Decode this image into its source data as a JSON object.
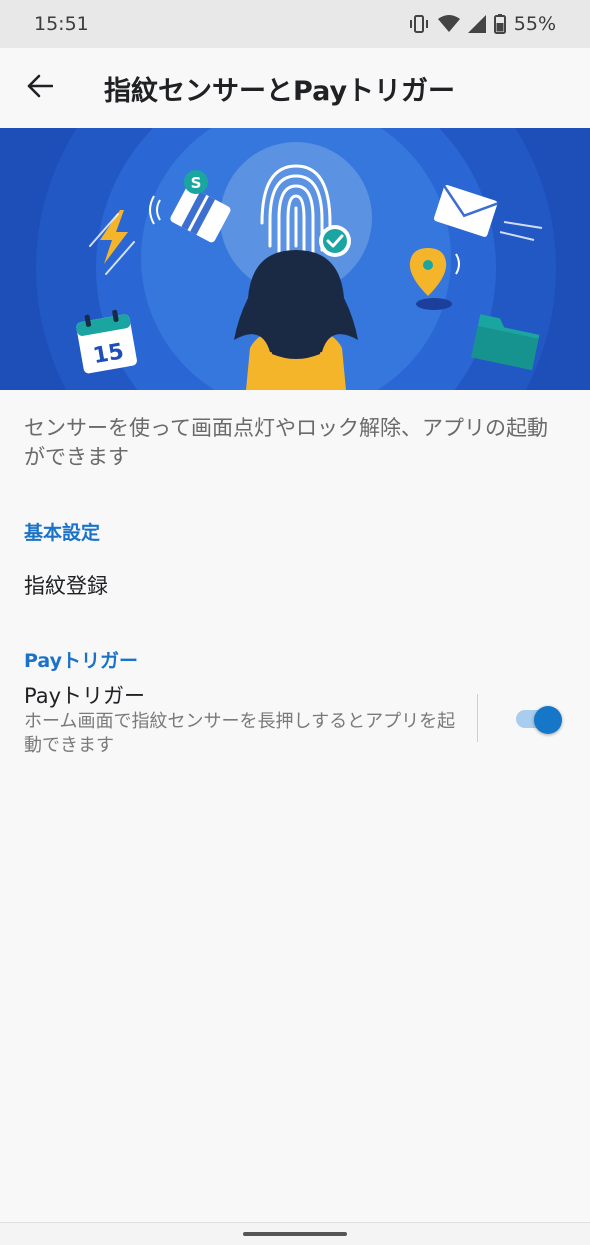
{
  "status_bar": {
    "time": "15:51",
    "battery": "55%",
    "icons": [
      "vibrate-icon",
      "wifi-icon",
      "signal-icon",
      "battery-icon"
    ]
  },
  "app_bar": {
    "title": "指紋センサーとPayトリガー",
    "back_icon": "back-arrow-icon"
  },
  "description": "センサーを使って画面点灯やロック解除、アプリの起動ができます",
  "sections": {
    "basic": {
      "header": "基本設定",
      "items": [
        {
          "title": "指紋登録"
        }
      ]
    },
    "pay": {
      "header": "Payトリガー",
      "item": {
        "title": "Payトリガー",
        "summary": "ホーム画面で指紋センサーを長押しするとアプリを起動できます",
        "enabled": true
      }
    }
  },
  "colors": {
    "accent": "#1a73c8",
    "hero_background": "#1e4fb8",
    "switch_thumb": "#1677c9",
    "switch_track": "#a9cdee"
  },
  "hero_icons": [
    "fingerprint-icon",
    "check-icon",
    "lightning-icon",
    "payment-card-icon",
    "envelope-icon",
    "location-pin-icon",
    "calendar-icon",
    "folder-icon"
  ],
  "hero_calendar_day": "15"
}
